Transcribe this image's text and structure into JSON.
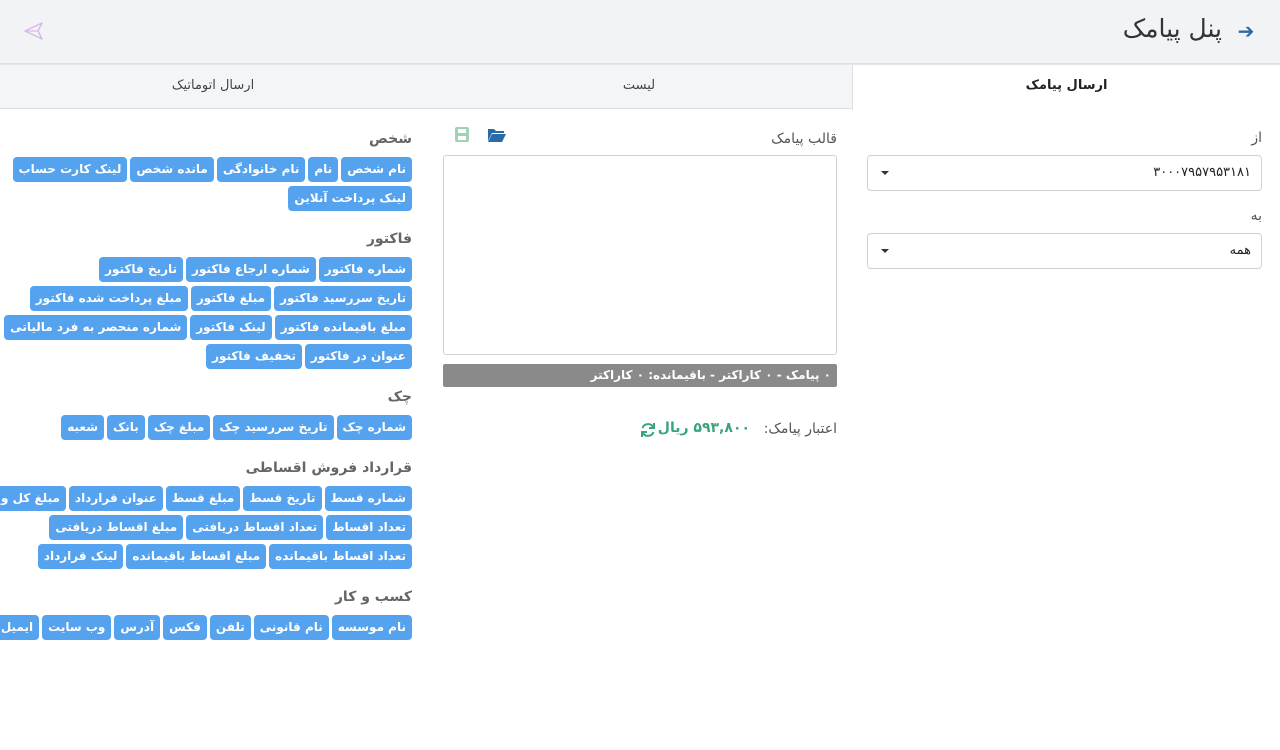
{
  "header": {
    "title": "پنل پیامک",
    "back_icon": "arrow-right-icon",
    "send_icon": "paper-plane-icon"
  },
  "tabs": [
    {
      "label": "ارسال پیامک",
      "active": true
    },
    {
      "label": "لیست",
      "active": false
    },
    {
      "label": "ارسال اتوماتیک",
      "active": false
    }
  ],
  "form": {
    "from_label": "از",
    "from_value": "۳۰۰۰۷۹۵۷۹۵۳۱۸۱",
    "to_label": "به",
    "to_value": "همه"
  },
  "template": {
    "label": "قالب پیامک",
    "text": "",
    "counter": "۰ پیامک - ۰ کاراکتر - باقیمانده: ۰ کاراکتر"
  },
  "credit": {
    "label": "اعتبار پیامک:",
    "value": "۵۹۳,۸۰۰ ریال"
  },
  "colors": {
    "chip": "#55a2ee",
    "credit": "#3aa57a",
    "accent": "#2b6aa8"
  },
  "groups": [
    {
      "title": "شخص",
      "rows": [
        [
          "نام شخص",
          "نام",
          "نام خانوادگی",
          "مانده شخص",
          "لینک کارت حساب"
        ],
        [
          "لینک پرداخت آنلاین"
        ]
      ]
    },
    {
      "title": "فاکتور",
      "rows": [
        [
          "شماره فاکتور",
          "شماره ارجاع فاکتور",
          "تاریخ فاکتور"
        ],
        [
          "تاریخ سررسید فاکتور",
          "مبلغ فاکتور",
          "مبلغ پرداخت شده فاکتور"
        ],
        [
          "مبلغ باقیمانده فاکتور",
          "لینک فاکتور",
          "شماره منحصر به فرد مالیاتی"
        ],
        [
          "عنوان در فاکتور",
          "تخفیف فاکتور"
        ]
      ]
    },
    {
      "title": "چک",
      "rows": [
        [
          "شماره چک",
          "تاریخ سررسید چک",
          "مبلغ چک",
          "بانک",
          "شعبه"
        ]
      ]
    },
    {
      "title": "قرارداد فروش اقساطی",
      "rows": [
        [
          "شماره قسط",
          "تاریخ قسط",
          "مبلغ قسط",
          "عنوان قرارداد",
          "مبلغ کل وام"
        ],
        [
          "تعداد اقساط",
          "تعداد اقساط دریافتی",
          "مبلغ اقساط دریافتی"
        ],
        [
          "تعداد اقساط باقیمانده",
          "مبلغ اقساط باقیمانده",
          "لینک قرارداد"
        ]
      ]
    },
    {
      "title": "کسب و کار",
      "rows": [
        [
          "نام موسسه",
          "نام قانونی",
          "تلفن",
          "فکس",
          "آدرس",
          "وب سایت",
          "ایمیل"
        ]
      ]
    }
  ]
}
